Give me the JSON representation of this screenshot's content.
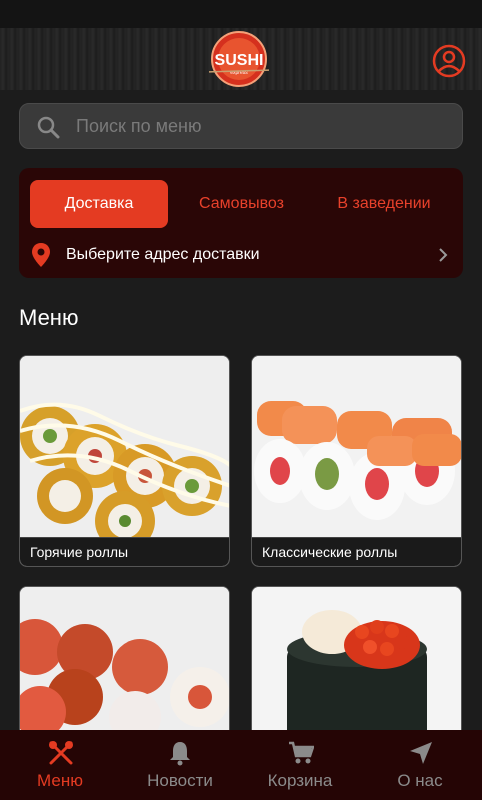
{
  "header": {
    "logo_text": "SUSHI",
    "logo_subtext": "express"
  },
  "search": {
    "placeholder": "Поиск по меню"
  },
  "delivery": {
    "tabs": [
      {
        "label": "Доставка",
        "active": true
      },
      {
        "label": "Самовывоз",
        "active": false
      },
      {
        "label": "В заведении",
        "active": false
      }
    ],
    "address_prompt": "Выберите адрес доставки"
  },
  "menu": {
    "title": "Меню",
    "categories": [
      {
        "label": "Горячие роллы"
      },
      {
        "label": "Классические роллы"
      },
      {
        "label": ""
      },
      {
        "label": ""
      }
    ]
  },
  "nav": {
    "items": [
      {
        "label": "Меню",
        "icon": "cutlery-icon",
        "active": true
      },
      {
        "label": "Новости",
        "icon": "bell-icon",
        "active": false
      },
      {
        "label": "Корзина",
        "icon": "cart-icon",
        "active": false
      },
      {
        "label": "О нас",
        "icon": "location-arrow-icon",
        "active": false
      }
    ]
  },
  "colors": {
    "accent": "#e43b22",
    "background": "#1c1c1c",
    "panel": "#2a0606",
    "tabbar": "#250505"
  }
}
